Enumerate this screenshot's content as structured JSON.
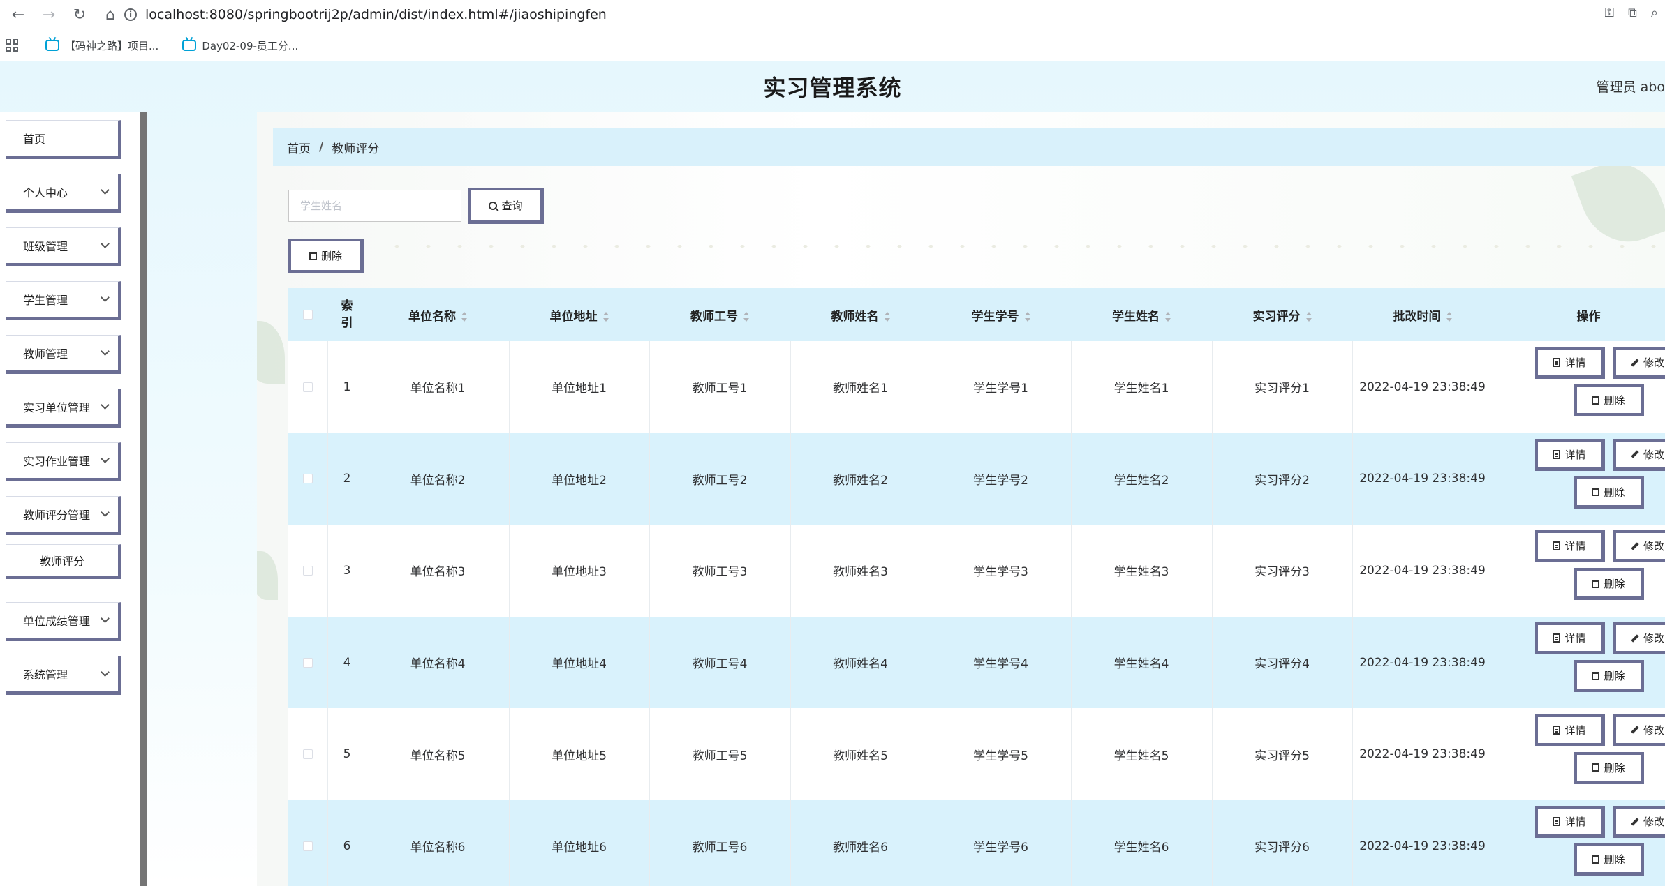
{
  "browser": {
    "url": "localhost:8080/springbootrij2p/admin/dist/index.html#/jiaoshipingfen",
    "bookmarks": [
      "【码神之路】项目...",
      "Day02-09-员工分..."
    ]
  },
  "app": {
    "title": "实习管理系统",
    "user": "管理员 abo"
  },
  "sidebar": {
    "items": [
      {
        "label": "首页",
        "has_arrow": false
      },
      {
        "label": "个人中心",
        "has_arrow": true
      },
      {
        "label": "班级管理",
        "has_arrow": true
      },
      {
        "label": "学生管理",
        "has_arrow": true
      },
      {
        "label": "教师管理",
        "has_arrow": true
      },
      {
        "label": "实习单位管理",
        "has_arrow": true
      },
      {
        "label": "实习作业管理",
        "has_arrow": true
      },
      {
        "label": "教师评分管理",
        "has_arrow": true
      },
      {
        "label": "教师评分",
        "has_arrow": false
      },
      {
        "label": "单位成绩管理",
        "has_arrow": true
      },
      {
        "label": "系统管理",
        "has_arrow": true
      }
    ]
  },
  "breadcrumb": {
    "home": "首页",
    "separator": "/",
    "current": "教师评分"
  },
  "search": {
    "placeholder": "学生姓名",
    "button": "查询"
  },
  "toolbar": {
    "delete": "删除"
  },
  "table": {
    "headers": {
      "index": "索引",
      "unit_name": "单位名称",
      "unit_address": "单位地址",
      "teacher_no": "教师工号",
      "teacher_name": "教师姓名",
      "student_no": "学生学号",
      "student_name": "学生姓名",
      "score": "实习评分",
      "time": "批改时间",
      "ops": "操作"
    },
    "ops_labels": {
      "detail": "详情",
      "edit": "修改",
      "delete": "删除"
    },
    "rows": [
      {
        "index": "1",
        "unit_name": "单位名称1",
        "unit_address": "单位地址1",
        "teacher_no": "教师工号1",
        "teacher_name": "教师姓名1",
        "student_no": "学生学号1",
        "student_name": "学生姓名1",
        "score": "实习评分1",
        "time": "2022-04-19 23:38:49"
      },
      {
        "index": "2",
        "unit_name": "单位名称2",
        "unit_address": "单位地址2",
        "teacher_no": "教师工号2",
        "teacher_name": "教师姓名2",
        "student_no": "学生学号2",
        "student_name": "学生姓名2",
        "score": "实习评分2",
        "time": "2022-04-19 23:38:49"
      },
      {
        "index": "3",
        "unit_name": "单位名称3",
        "unit_address": "单位地址3",
        "teacher_no": "教师工号3",
        "teacher_name": "教师姓名3",
        "student_no": "学生学号3",
        "student_name": "学生姓名3",
        "score": "实习评分3",
        "time": "2022-04-19 23:38:49"
      },
      {
        "index": "4",
        "unit_name": "单位名称4",
        "unit_address": "单位地址4",
        "teacher_no": "教师工号4",
        "teacher_name": "教师姓名4",
        "student_no": "学生学号4",
        "student_name": "学生姓名4",
        "score": "实习评分4",
        "time": "2022-04-19 23:38:49"
      },
      {
        "index": "5",
        "unit_name": "单位名称5",
        "unit_address": "单位地址5",
        "teacher_no": "教师工号5",
        "teacher_name": "教师姓名5",
        "student_no": "学生学号5",
        "student_name": "学生姓名5",
        "score": "实习评分5",
        "time": "2022-04-19 23:38:49"
      },
      {
        "index": "6",
        "unit_name": "单位名称6",
        "unit_address": "单位地址6",
        "teacher_no": "教师工号6",
        "teacher_name": "教师姓名6",
        "student_no": "学生学号6",
        "student_name": "学生姓名6",
        "score": "实习评分6",
        "time": "2022-04-19 23:38:49"
      }
    ]
  },
  "colors": {
    "header_bg": "#e6f7fd",
    "row_alt": "#d9f2fc",
    "button_border": "#6b6e94",
    "sidebar_divider": "#757575"
  }
}
